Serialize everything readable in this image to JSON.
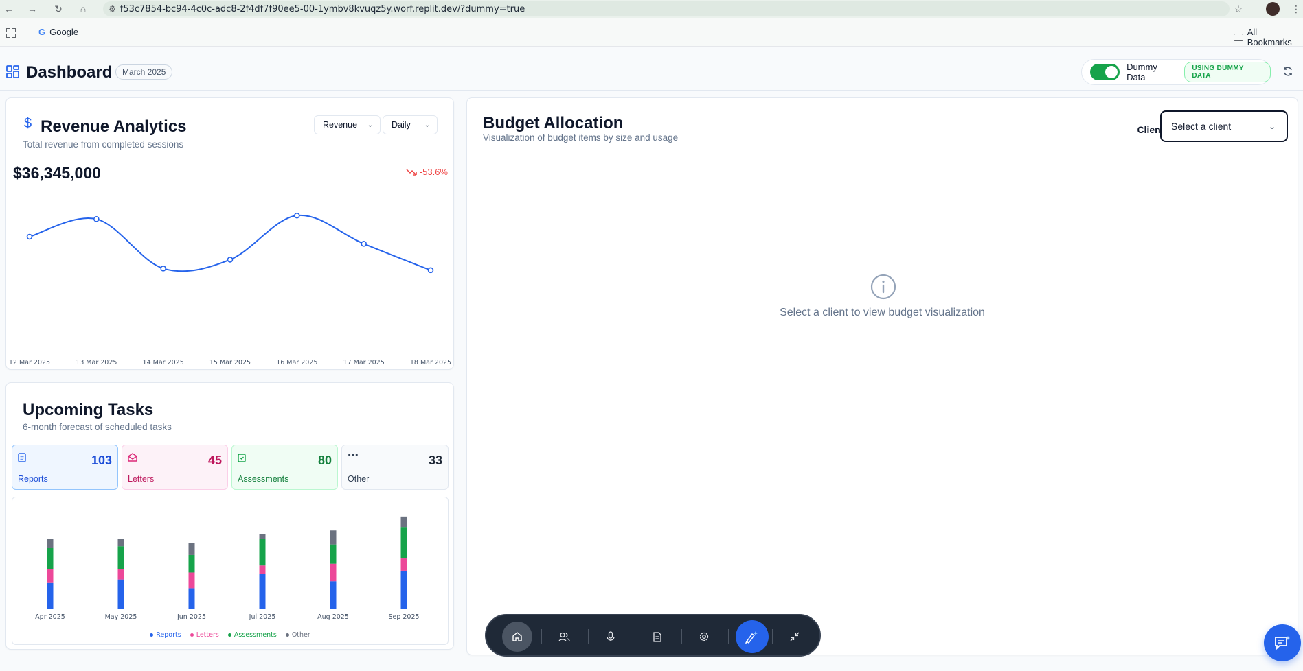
{
  "browser": {
    "url": "f53c7854-bc94-4c0c-adc8-2f4df7f90ee5-00-1ymbv8kvuqz5y.worf.replit.dev/?dummy=true",
    "bookmarks": [
      "Google"
    ],
    "all_bookmarks": "All Bookmarks"
  },
  "header": {
    "title": "Dashboard",
    "date_badge": "March 2025",
    "dummy_toggle_label": "Dummy Data",
    "dummy_toggle_on": true,
    "dummy_badge": "USING DUMMY DATA"
  },
  "revenue": {
    "title": "Revenue Analytics",
    "subtitle": "Total revenue from completed sessions",
    "metric_select": "Revenue",
    "period_select": "Daily",
    "total": "$36,345,000",
    "change": "-53.6%"
  },
  "tasks": {
    "title": "Upcoming Tasks",
    "subtitle": "6-month forecast of scheduled tasks",
    "tiles": [
      {
        "label": "Reports",
        "value": "103"
      },
      {
        "label": "Letters",
        "value": "45"
      },
      {
        "label": "Assessments",
        "value": "80"
      },
      {
        "label": "Other",
        "value": "33"
      }
    ],
    "legend": [
      "Reports",
      "Letters",
      "Assessments",
      "Other"
    ]
  },
  "budget": {
    "title": "Budget Allocation",
    "subtitle": "Visualization of budget items by size and usage",
    "client_label": "Client:",
    "client_placeholder": "Select a client",
    "empty_message": "Select a client to view budget visualization"
  },
  "colors": {
    "accent": "#2563eb",
    "reports": "#2563eb",
    "letters": "#ec4899",
    "assessments": "#16a34a",
    "other": "#6b7280",
    "negative": "#ef4444"
  },
  "dock_icons": [
    "home-icon",
    "users-icon",
    "microphone-icon",
    "document-icon",
    "gear-icon",
    "magic-pen-icon",
    "minimize-icon"
  ],
  "chart_data": [
    {
      "type": "line",
      "title": "",
      "x": [
        "12 Mar 2025",
        "13 Mar 2025",
        "14 Mar 2025",
        "15 Mar 2025",
        "16 Mar 2025",
        "17 Mar 2025",
        "18 Mar 2025"
      ],
      "series": [
        {
          "values": [
            6.2,
            7.2,
            4.4,
            4.9,
            7.4,
            5.8,
            4.3
          ]
        }
      ],
      "ylim": [
        2,
        9
      ],
      "grid": false
    },
    {
      "type": "bar",
      "stacked": true,
      "categories": [
        "Apr 2025",
        "May 2025",
        "Jun 2025",
        "Jul 2025",
        "Aug 2025",
        "Sep 2025"
      ],
      "series": [
        {
          "name": "Reports",
          "values": [
            15,
            17,
            12,
            20,
            16,
            22
          ]
        },
        {
          "name": "Letters",
          "values": [
            8,
            6,
            9,
            5,
            10,
            7
          ]
        },
        {
          "name": "Assessments",
          "values": [
            12,
            13,
            10,
            15,
            11,
            18
          ]
        },
        {
          "name": "Other",
          "values": [
            5,
            4,
            7,
            3,
            8,
            6
          ]
        }
      ],
      "ylim": [
        0,
        60
      ],
      "legend": "bottom"
    }
  ]
}
